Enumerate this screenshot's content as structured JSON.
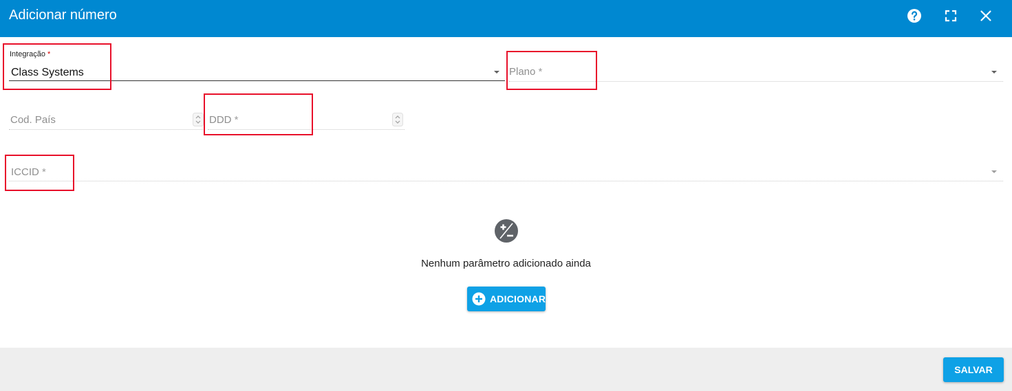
{
  "dialog": {
    "title": "Adicionar número"
  },
  "fields": {
    "integracao": {
      "label": "Integração",
      "required_mark": "*",
      "value": "Class Systems"
    },
    "plano": {
      "label": "Plano",
      "required_mark": "*"
    },
    "cod_pais": {
      "label": "Cod. País"
    },
    "ddd": {
      "label": "DDD",
      "required_mark": "*"
    },
    "iccid": {
      "label": "ICCID",
      "required_mark": "*"
    }
  },
  "parameters": {
    "empty_text": "Nenhum parâmetro adicionado ainda",
    "add_label": "ADICIONAR"
  },
  "footer": {
    "save_label": "SALVAR"
  },
  "colors": {
    "header": "#0088d1",
    "button": "#0ea1e6",
    "highlight": "#e8102a"
  }
}
